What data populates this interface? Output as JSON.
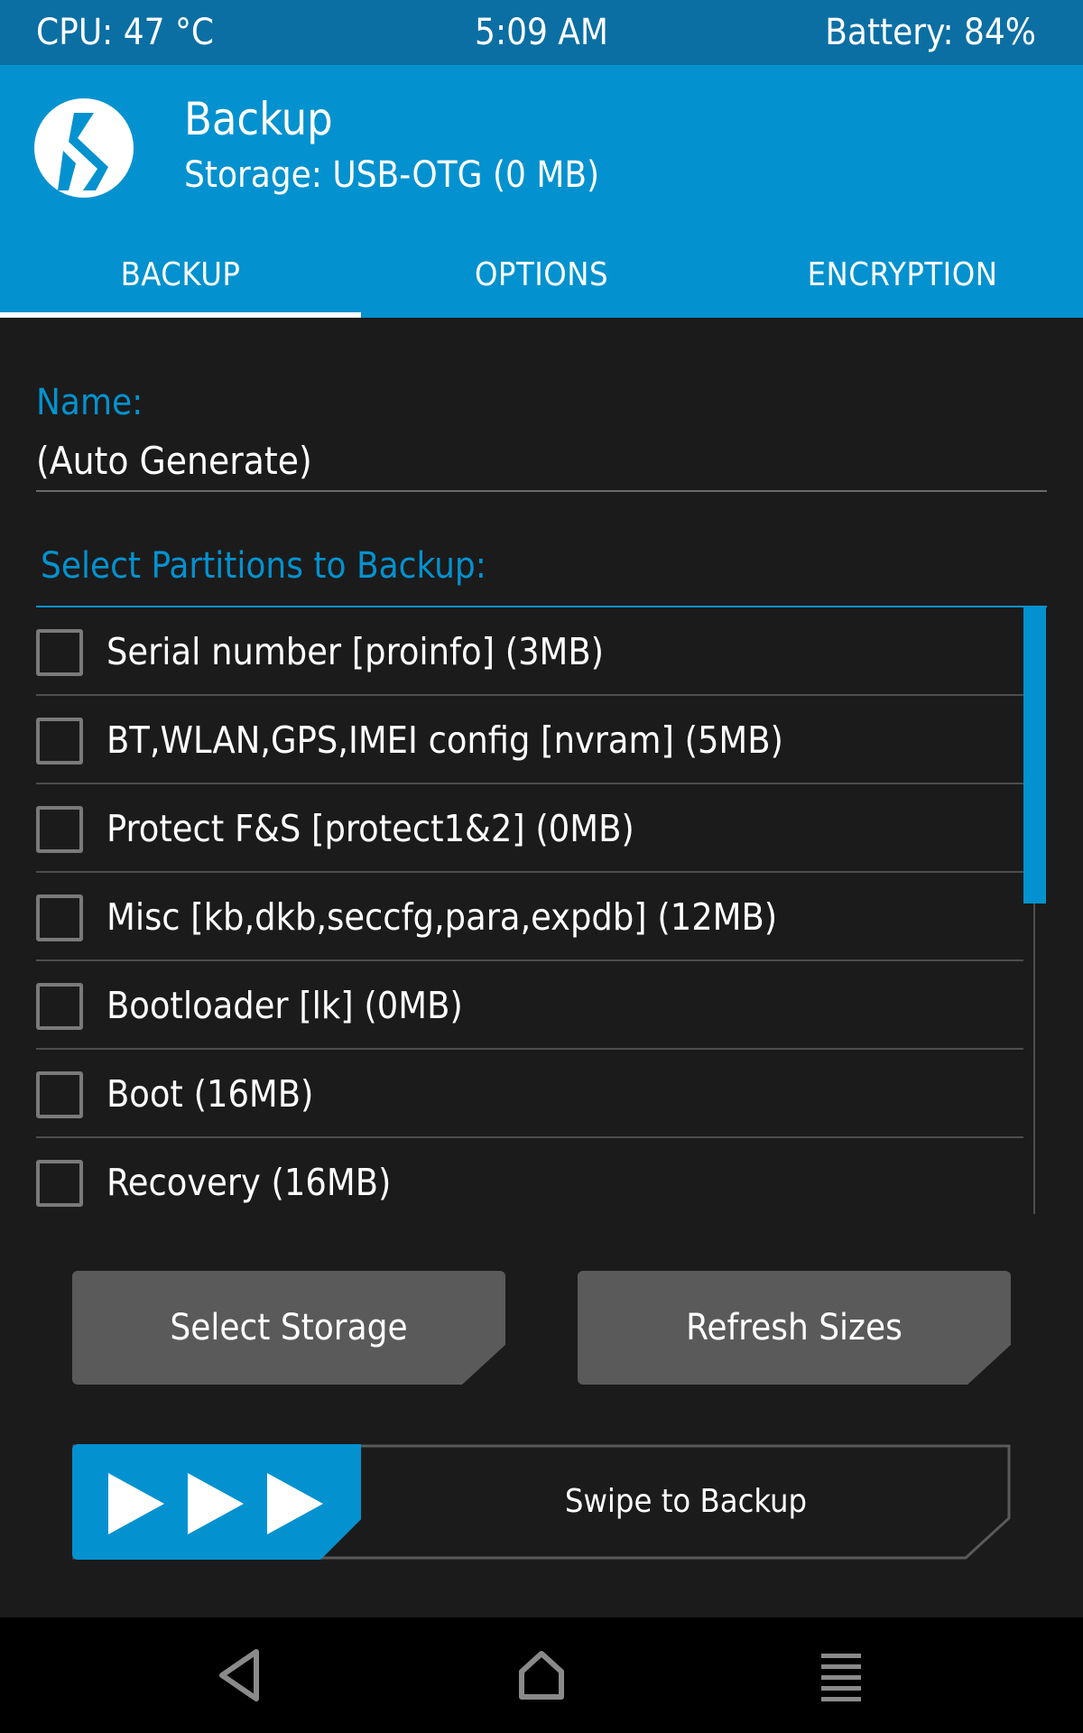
{
  "status_bar": {
    "cpu": "CPU: 47 °C",
    "time": "5:09 AM",
    "battery": "Battery: 84%"
  },
  "header": {
    "title": "Backup",
    "storage": "Storage: USB-OTG (0 MB)",
    "logo_icon": "twrp-logo-icon"
  },
  "tabs": [
    {
      "label": "BACKUP",
      "selected": true
    },
    {
      "label": "OPTIONS",
      "selected": false
    },
    {
      "label": "ENCRYPTION",
      "selected": false
    }
  ],
  "name_field": {
    "label": "Name:",
    "value": "(Auto Generate)"
  },
  "partitions": {
    "label": "Select Partitions to Backup:",
    "items": [
      {
        "label": "Serial number [proinfo] (3MB)",
        "checked": false
      },
      {
        "label": "BT,WLAN,GPS,IMEI config [nvram] (5MB)",
        "checked": false
      },
      {
        "label": "Protect F&S [protect1&2] (0MB)",
        "checked": false
      },
      {
        "label": "Misc [kb,dkb,seccfg,para,expdb] (12MB)",
        "checked": false
      },
      {
        "label": "Bootloader [lk] (0MB)",
        "checked": false
      },
      {
        "label": "Boot (16MB)",
        "checked": false
      },
      {
        "label": "Recovery (16MB)",
        "checked": false
      }
    ]
  },
  "buttons": {
    "select_storage": "Select Storage",
    "refresh_sizes": "Refresh Sizes"
  },
  "swipe": {
    "label": "Swipe to Backup",
    "icon": "triple-play-arrow-icon"
  },
  "nav": {
    "back_icon": "back-triangle-icon",
    "home_icon": "home-icon",
    "menu_icon": "menu-lines-icon"
  },
  "colors": {
    "accent": "#0392cf",
    "status_bar": "#0b6fa4",
    "background": "#1b1b1b",
    "button": "#5a5a5a"
  }
}
